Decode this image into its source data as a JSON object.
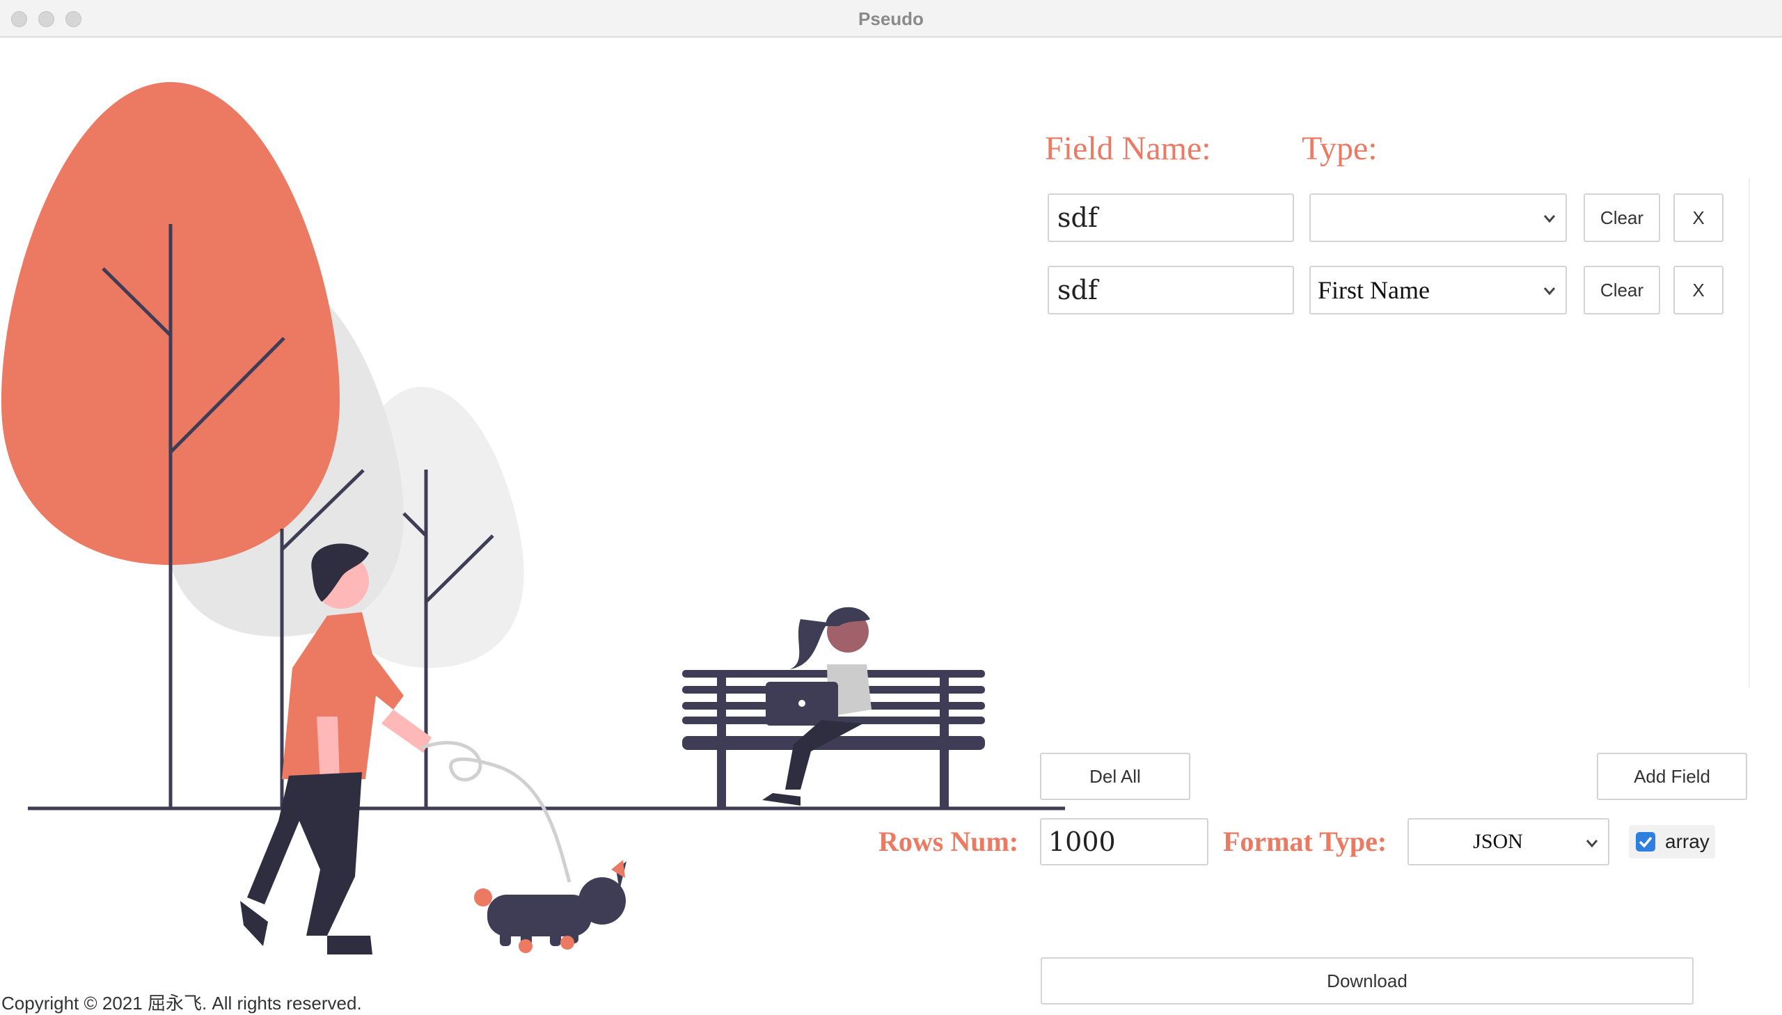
{
  "window": {
    "title": "Pseudo"
  },
  "headers": {
    "field_name": "Field Name:",
    "type": "Type:"
  },
  "fields": [
    {
      "name": "sdf",
      "type": "",
      "clear_label": "Clear",
      "remove_label": "X"
    },
    {
      "name": "sdf",
      "type": "First Name",
      "clear_label": "Clear",
      "remove_label": "X"
    }
  ],
  "actions": {
    "del_all": "Del All",
    "add_field": "Add Field",
    "download": "Download"
  },
  "options": {
    "rows_label": "Rows Num:",
    "rows_value": "1000",
    "format_label": "Format Type:",
    "format_value": "JSON",
    "array_label": "array",
    "array_checked": true
  },
  "footer": {
    "copyright": "Copyright © 2021 屈永飞. All rights reserved."
  },
  "colors": {
    "accent": "#ec7a63",
    "dark": "#3f3d56",
    "tree_gray": "#e6e6e6",
    "checkbox": "#2f7fe0"
  },
  "icons": [
    "chevron-down-icon",
    "checkmark-icon"
  ]
}
